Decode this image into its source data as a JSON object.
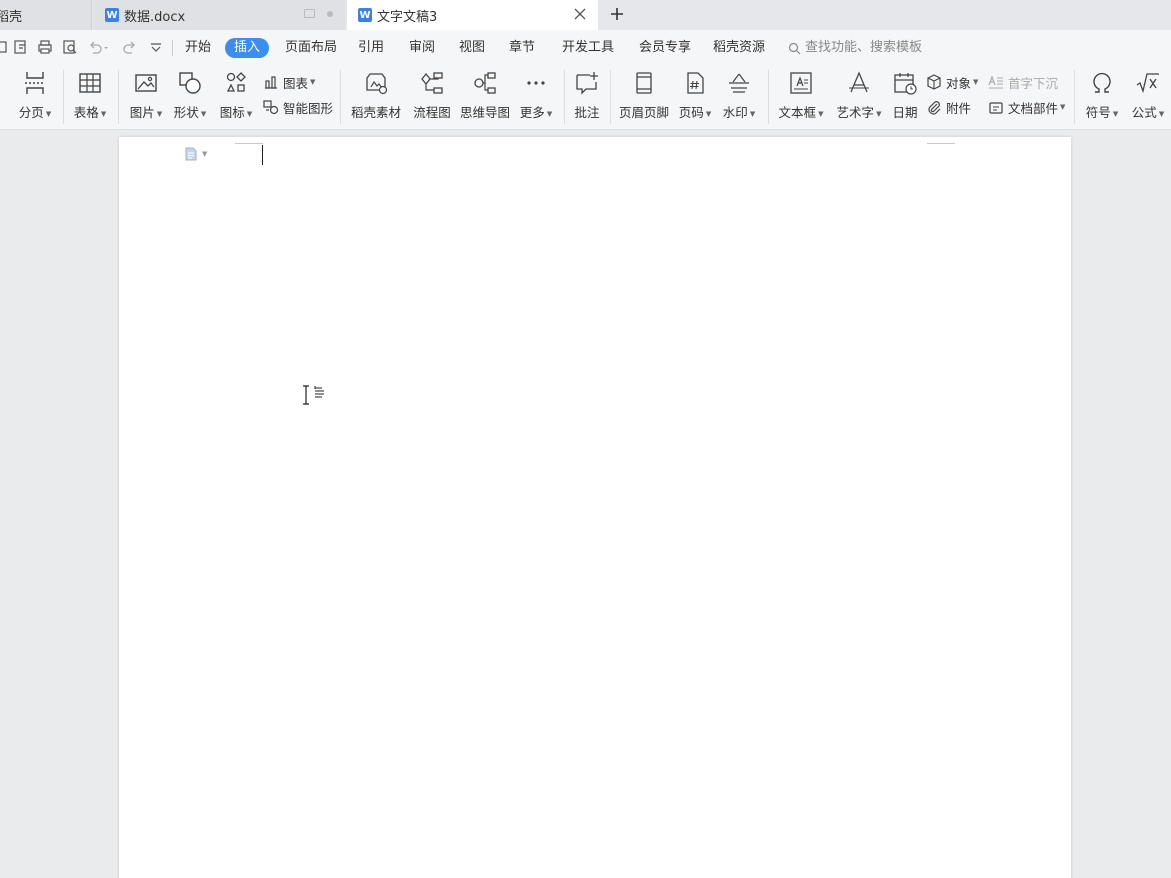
{
  "tabs": [
    {
      "label": "稻壳"
    },
    {
      "label": "数据.docx",
      "icon": "wps-writer-icon"
    },
    {
      "label": "文字文稿3",
      "icon": "wps-writer-icon",
      "active": true
    }
  ],
  "menu": {
    "items": [
      "开始",
      "插入",
      "页面布局",
      "引用",
      "审阅",
      "视图",
      "章节",
      "开发工具",
      "会员专享",
      "稻壳资源"
    ],
    "active": "插入",
    "search_placeholder": "查找功能、搜索模板"
  },
  "ribbon": {
    "page_break": "分页",
    "table": "表格",
    "picture": "图片",
    "shape": "形状",
    "icons": "图标",
    "chart": "图表",
    "smart_art": "智能图形",
    "docer_material": "稻壳素材",
    "flowchart": "流程图",
    "mindmap": "思维导图",
    "more": "更多",
    "comment": "批注",
    "header_footer": "页眉页脚",
    "page_number": "页码",
    "watermark": "水印",
    "textbox": "文本框",
    "wordart": "艺术字",
    "date": "日期",
    "object": "对象",
    "drop_cap": "首字下沉",
    "attachment": "附件",
    "doc_parts": "文档部件",
    "symbol": "符号",
    "formula": "公式"
  },
  "colors": {
    "accent": "#3c8df0",
    "writer_icon": "#3b82e8"
  }
}
